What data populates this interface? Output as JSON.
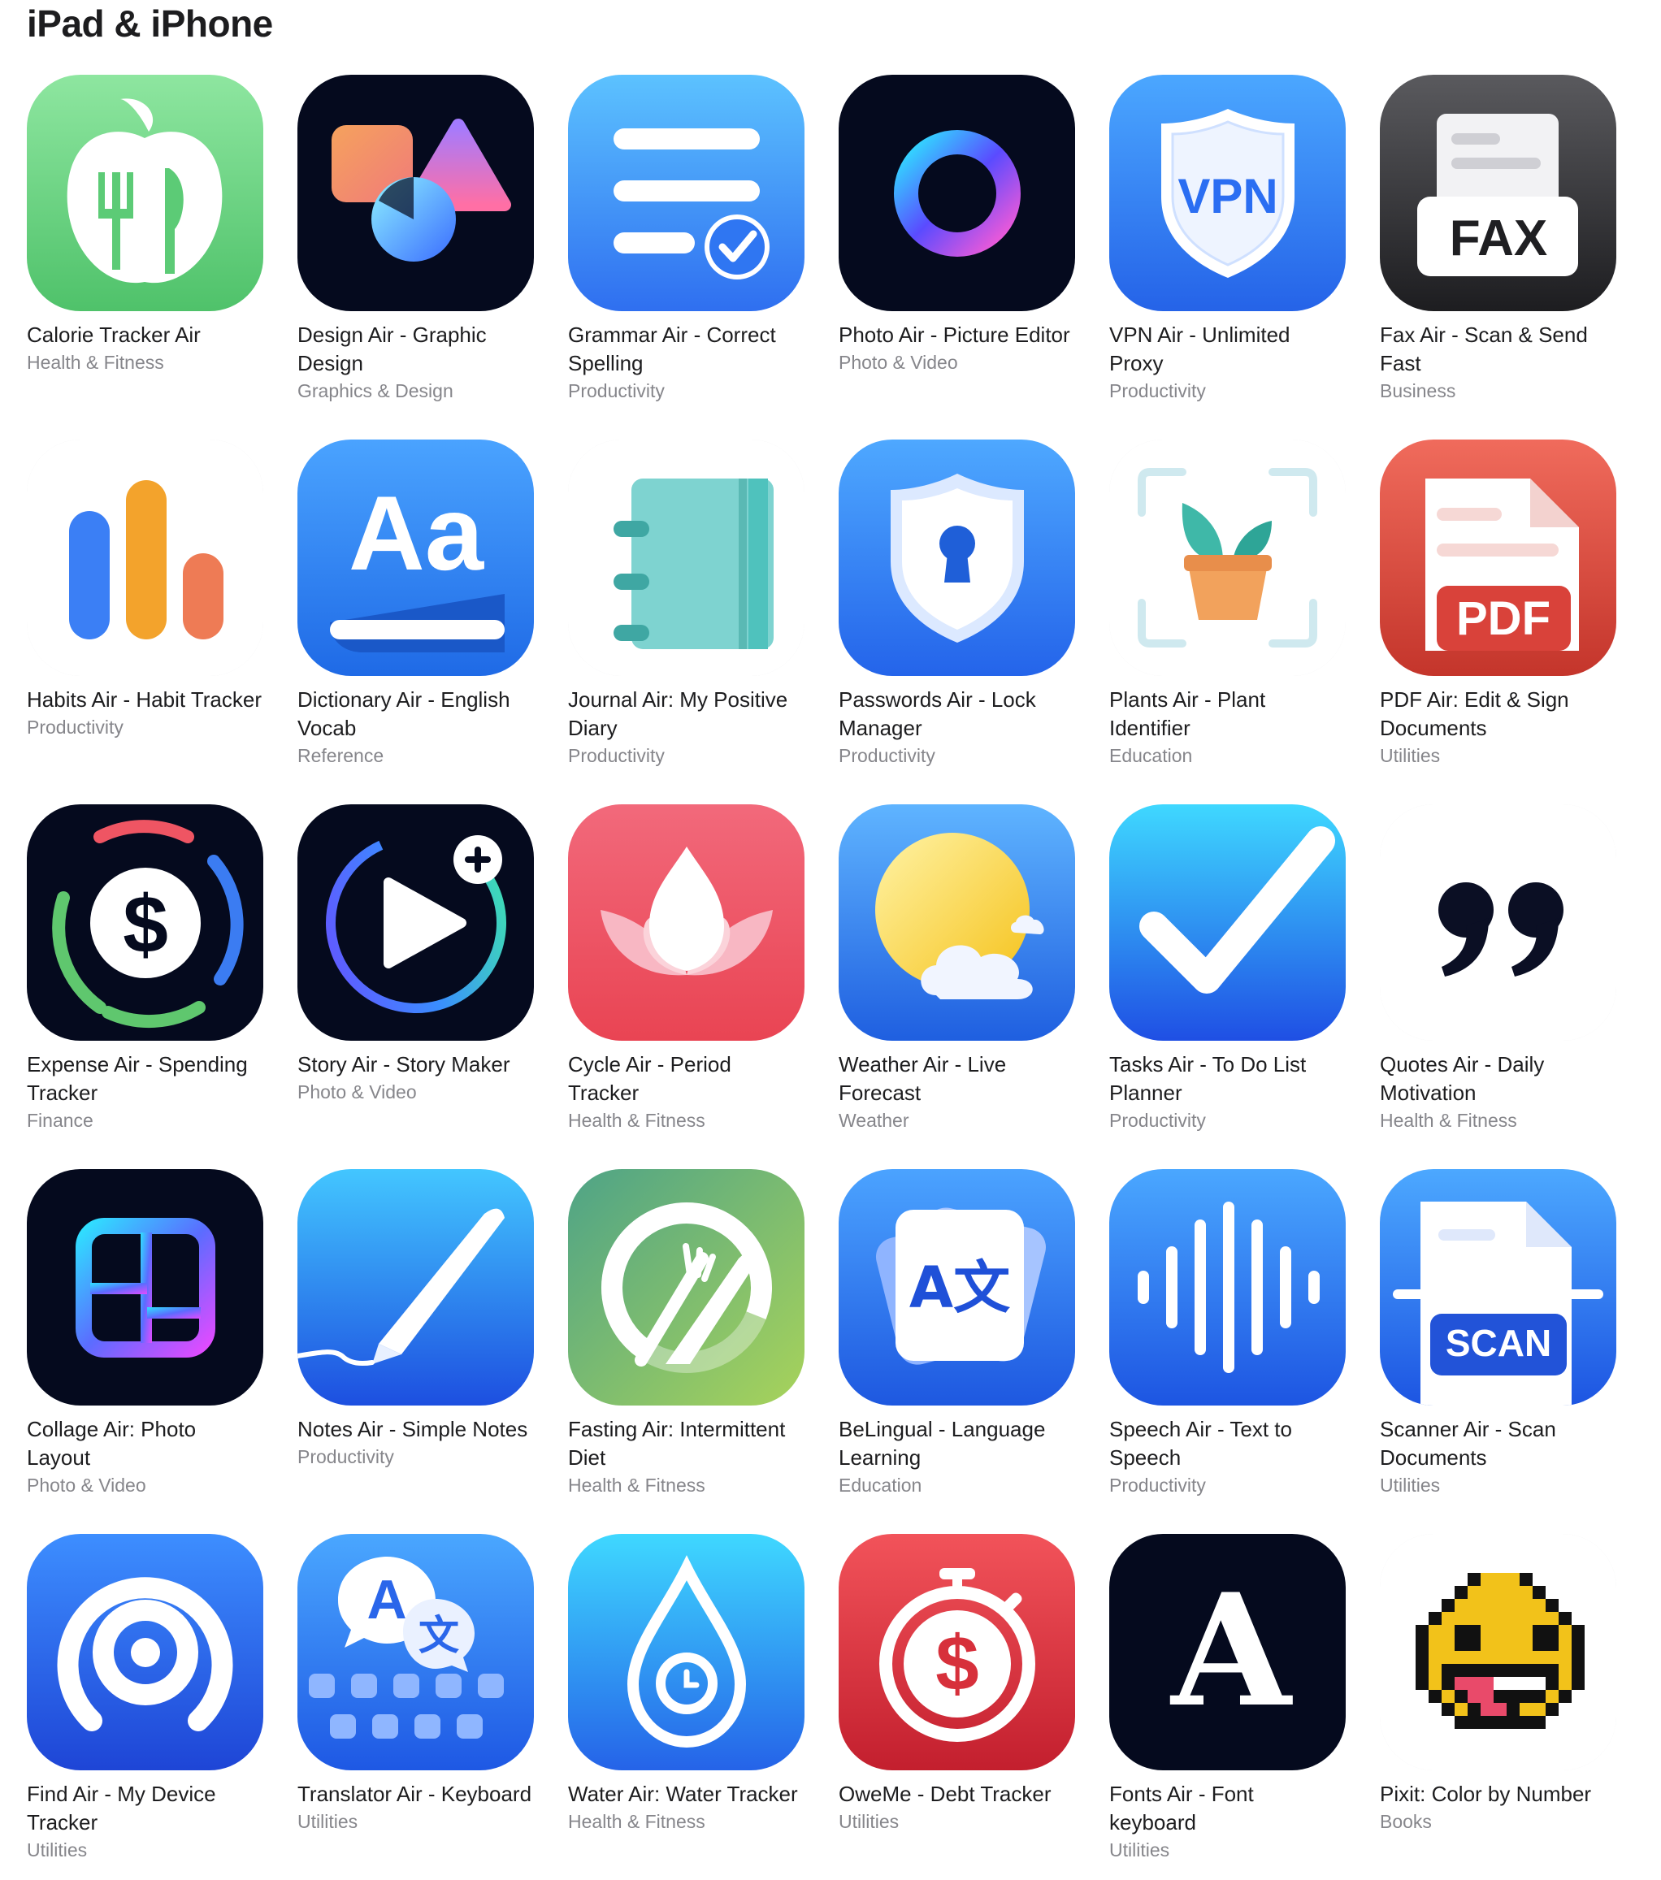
{
  "section": {
    "title": "iPad & iPhone"
  },
  "apps": [
    {
      "name": "Calorie Tracker Air",
      "category": "Health & Fitness",
      "icon": "apple-fork-knife-icon"
    },
    {
      "name": "Design Air - Graphic Design",
      "category": "Graphics & Design",
      "icon": "shapes-icon"
    },
    {
      "name": "Grammar Air - Correct Spelling",
      "category": "Productivity",
      "icon": "text-lines-check-icon"
    },
    {
      "name": "Photo Air - Picture Editor",
      "category": "Photo & Video",
      "icon": "gradient-ring-icon"
    },
    {
      "name": "VPN Air - Unlimited Proxy",
      "category": "Productivity",
      "icon": "vpn-shield-icon",
      "icon_text": "VPN"
    },
    {
      "name": "Fax Air - Scan & Send Fast",
      "category": "Business",
      "icon": "fax-machine-icon",
      "icon_text": "FAX"
    },
    {
      "name": "Habits Air - Habit Tracker",
      "category": "Productivity",
      "icon": "bar-chart-icon"
    },
    {
      "name": "Dictionary Air - English Vocab",
      "category": "Reference",
      "icon": "dictionary-book-icon",
      "icon_text": "Aa"
    },
    {
      "name": "Journal Air: My Positive Diary",
      "category": "Productivity",
      "icon": "notebook-icon"
    },
    {
      "name": "Passwords Air - Lock Manager",
      "category": "Productivity",
      "icon": "keyhole-shield-icon"
    },
    {
      "name": "Plants Air - Plant Identifier",
      "category": "Education",
      "icon": "potted-plant-icon"
    },
    {
      "name": "PDF Air: Edit & Sign Documents",
      "category": "Utilities",
      "icon": "pdf-document-icon",
      "icon_text": "PDF"
    },
    {
      "name": "Expense Air - Spending Tracker",
      "category": "Finance",
      "icon": "dollar-ring-icon",
      "icon_text": "$"
    },
    {
      "name": "Story Air - Story Maker",
      "category": "Photo & Video",
      "icon": "play-ring-plus-icon"
    },
    {
      "name": "Cycle Air - Period Tracker",
      "category": "Health & Fitness",
      "icon": "lotus-icon"
    },
    {
      "name": "Weather Air - Live Forecast",
      "category": "Weather",
      "icon": "sun-cloud-icon"
    },
    {
      "name": "Tasks Air - To Do List Planner",
      "category": "Productivity",
      "icon": "checkmark-icon"
    },
    {
      "name": "Quotes Air - Daily Motivation",
      "category": "Health & Fitness",
      "icon": "quote-marks-icon"
    },
    {
      "name": "Collage Air: Photo Layout",
      "category": "Photo & Video",
      "icon": "collage-layout-icon"
    },
    {
      "name": "Notes Air - Simple Notes",
      "category": "Productivity",
      "icon": "pen-icon"
    },
    {
      "name": "Fasting Air: Intermittent Diet",
      "category": "Health & Fitness",
      "icon": "plate-fork-knife-icon"
    },
    {
      "name": "BeLingual - Language Learning",
      "category": "Education",
      "icon": "translate-cards-icon",
      "icon_text": "A文"
    },
    {
      "name": "Speech Air - Text to Speech",
      "category": "Productivity",
      "icon": "sound-wave-icon"
    },
    {
      "name": "Scanner Air - Scan Documents",
      "category": "Utilities",
      "icon": "scanner-document-icon",
      "icon_text": "SCAN"
    },
    {
      "name": "Find Air - My Device Tracker",
      "category": "Utilities",
      "icon": "airtag-icon"
    },
    {
      "name": "Translator Air - Keyboard",
      "category": "Utilities",
      "icon": "translate-keyboard-icon",
      "icon_text": "A",
      "icon_text2": "文"
    },
    {
      "name": "Water Air: Water Tracker",
      "category": "Health & Fitness",
      "icon": "water-drop-clock-icon"
    },
    {
      "name": "OweMe - Debt Tracker",
      "category": "Utilities",
      "icon": "stopwatch-dollar-icon",
      "icon_text": "$"
    },
    {
      "name": "Fonts Air - Font keyboard",
      "category": "Utilities",
      "icon": "script-letter-icon",
      "icon_text": "A"
    },
    {
      "name": "Pixit: Color by Number",
      "category": "Books",
      "icon": "pixel-emoji-icon"
    }
  ]
}
